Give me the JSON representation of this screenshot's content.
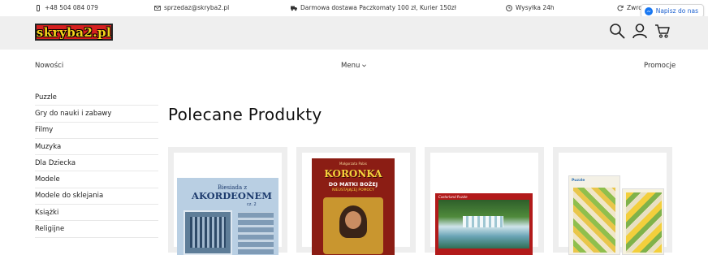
{
  "topbar": {
    "phone": "+48 504 084 079",
    "email": "sprzedaz@skryba2.pl",
    "shipping": "Darmowa dostawa Paczkomaty 100 zł, Kurier 150zł",
    "dispatch": "Wysyłka 24h",
    "returns": "Zwrot w",
    "chat_label": "Napisz do nas"
  },
  "header": {
    "logo_text": "skryba2.pl",
    "icons": [
      "search-icon",
      "user-icon",
      "cart-icon"
    ]
  },
  "nav": {
    "left": "Nowości",
    "center": "Menu",
    "right": "Promocje"
  },
  "sidebar": {
    "categories": [
      "Puzzle",
      "Gry do nauki i zabawy",
      "Filmy",
      "Muzyka",
      "Dla Dziecka",
      "Modele",
      "Modele do sklejania",
      "Książki",
      "Religijne"
    ]
  },
  "main": {
    "section_title": "Polecane Produkty",
    "products": [
      {
        "cover_title": "Biesiada z",
        "cover_main": "AKORDEONEM",
        "cover_sub": "cz. 2"
      },
      {
        "cover_author": "Małgorzata Pabis",
        "cover_main": "KORONKA",
        "cover_sub": "DO MATKI BOŻEJ",
        "cover_sub2": "NIEUSTAJĄCEJ POMOCY"
      },
      {
        "cover_brand": "Castorland Puzzle"
      },
      {
        "cover_brand": "Puzzle"
      }
    ]
  },
  "colors": {
    "header_bg": "#efefef",
    "logo_red": "#d6201f",
    "logo_yellow": "#f5d21b",
    "chat_blue": "#1877f2"
  }
}
